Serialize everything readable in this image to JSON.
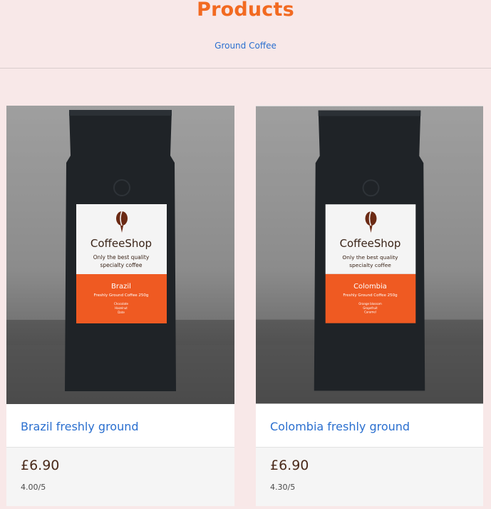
{
  "header": {
    "title": "Products",
    "breadcrumb": "Ground Coffee"
  },
  "products": [
    {
      "name": "Brazil freshly ground",
      "price": "£6.90",
      "rating": "4.00/5",
      "label": {
        "brand": "CoffeeShop",
        "tagline1": "Only the best quality",
        "tagline2": "specialty coffee",
        "origin": "Brazil",
        "subtitle": "Freshly Ground Coffee 250g",
        "notes": [
          "Chocolate",
          "Hazelnut",
          "Date"
        ]
      }
    },
    {
      "name": "Colombia freshly ground",
      "price": "£6.90",
      "rating": "4.30/5",
      "label": {
        "brand": "CoffeeShop",
        "tagline1": "Only the best quality",
        "tagline2": "specialty coffee",
        "origin": "Colombia",
        "subtitle": "Freshly Ground Coffee 250g",
        "notes": [
          "Orange blossom",
          "Grapefruit",
          "Caramel"
        ]
      }
    }
  ],
  "colors": {
    "accent": "#f26a21",
    "link": "#2a6fcf",
    "background": "#f8e8e8"
  }
}
